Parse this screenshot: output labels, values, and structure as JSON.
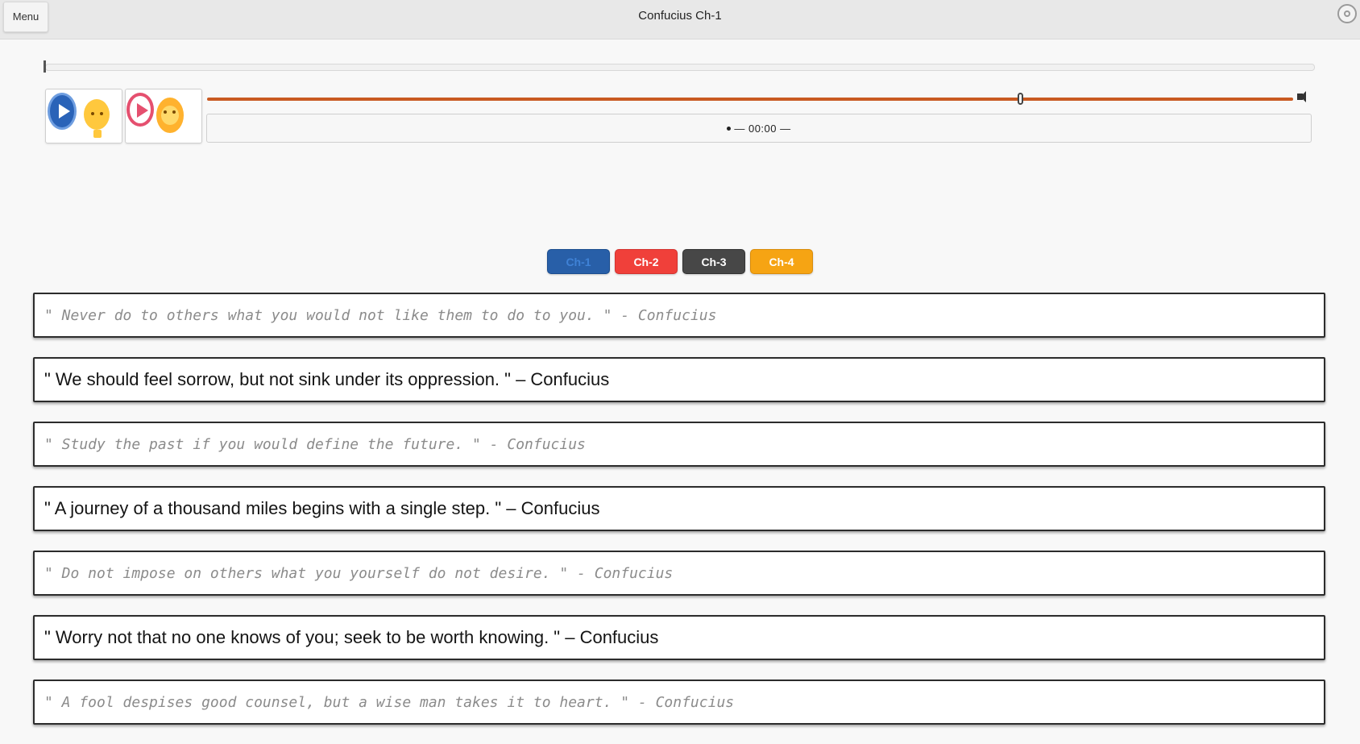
{
  "header": {
    "menu_label": "Menu",
    "title": "Confucius Ch-1",
    "corner_icon": "settings-circle-icon"
  },
  "player": {
    "seek_progress": 0.002,
    "voice_buttons": [
      {
        "icon": "play-icon",
        "color": "#2a63b8",
        "avatar": "man-emoji"
      },
      {
        "icon": "play-icon",
        "color": "#e5506f",
        "avatar": "woman-emoji"
      }
    ],
    "volume_level": 0.75,
    "volume_color": "#c95a22",
    "time_display": "— 00:00 —"
  },
  "tabs": [
    {
      "label": "Ch-1",
      "color": "#285fa8"
    },
    {
      "label": "Ch-2",
      "color": "#f0403a"
    },
    {
      "label": "Ch-3",
      "color": "#474747"
    },
    {
      "label": "Ch-4",
      "color": "#f6a413"
    }
  ],
  "quotes": [
    "\" Never do to others what you would not like them to do to you. \" - Confucius",
    "\" We should feel sorrow, but not sink under its oppression. \" – Confucius",
    "\" Study the past if you would define the future. \" - Confucius",
    "\" A journey of a thousand miles begins with a single step. \" – Confucius",
    "\" Do not impose on others what you yourself do not desire. \" - Confucius",
    "\" Worry not that no one knows of you; seek to be worth knowing. \" – Confucius",
    "\" A fool despises good counsel, but a wise man takes it to heart. \" - Confucius"
  ]
}
